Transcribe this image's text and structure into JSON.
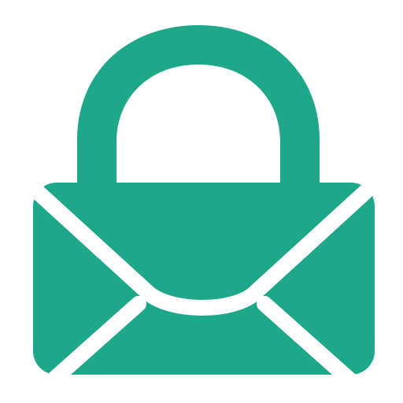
{
  "app": {
    "icon": "mail-lock-icon"
  },
  "colors": {
    "background": "#ffffff",
    "accent": "#1fa78a",
    "separator": "#ffffff"
  }
}
